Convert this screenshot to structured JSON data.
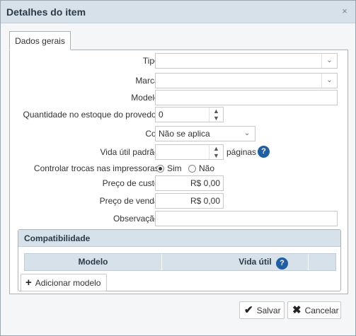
{
  "dialog": {
    "title": "Detalhes do item",
    "close_glyph": "×"
  },
  "tabs": [
    {
      "label": "Dados gerais",
      "selected": true
    }
  ],
  "form": {
    "tipo": {
      "label": "Tipo:",
      "value": ""
    },
    "marca": {
      "label": "Marca:",
      "value": ""
    },
    "modelo": {
      "label": "Modelo:",
      "value": ""
    },
    "estoque": {
      "label": "Quantidade no estoque do provedor:",
      "value": "0"
    },
    "cor": {
      "label": "Cor:",
      "value": "Não se aplica"
    },
    "vida_util": {
      "label": "Vida útil padrão:",
      "value": "",
      "unit": "páginas"
    },
    "trocas": {
      "label": "Controlar trocas nas impressoras:",
      "options": [
        "Sim",
        "Não"
      ],
      "selected": "Sim"
    },
    "custo": {
      "label": "Preço de custo:",
      "value": "R$ 0,00"
    },
    "venda": {
      "label": "Preço de venda:",
      "value": "R$ 0,00"
    },
    "observacao": {
      "label": "Observação:",
      "value": ""
    }
  },
  "compat": {
    "title": "Compatibilidade",
    "columns": [
      "Modelo",
      "Vida útil"
    ],
    "add_label": "Adicionar modelo"
  },
  "footer": {
    "save_label": "Salvar",
    "cancel_label": "Cancelar"
  },
  "icons": {
    "help": "question-circle-icon",
    "add": "plus-icon",
    "save": "check-icon",
    "cancel": "x-icon"
  },
  "colors": {
    "header": "#d6e1ea",
    "help": "#1f5fa5"
  }
}
